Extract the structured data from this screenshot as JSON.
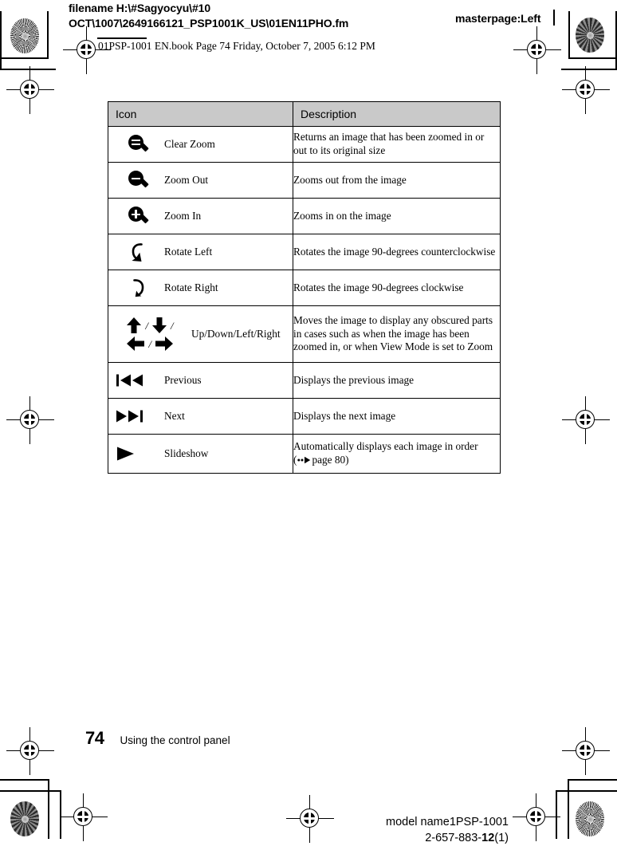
{
  "prepress": {
    "filename_line1": "filename H:\\#Sagyocyu\\#10",
    "filename_line2": "OCT\\1007\\2649166121_PSP1001K_US\\01EN11PHO.fm",
    "masterpage": "masterpage:Left",
    "book_line": "01PSP-1001 EN.book  Page 74  Friday, October 7, 2005  6:12 PM"
  },
  "table": {
    "headers": [
      "Icon",
      "Description"
    ],
    "header_bg": "#c9c9c9",
    "rows": [
      {
        "icon": "magnifier-equal-icon",
        "label": "Clear Zoom",
        "description": "Returns an image that has been zoomed in or out to its original size"
      },
      {
        "icon": "magnifier-minus-icon",
        "label": "Zoom Out",
        "description": "Zooms out from the image"
      },
      {
        "icon": "magnifier-plus-icon",
        "label": "Zoom In",
        "description": "Zooms in on the image"
      },
      {
        "icon": "rotate-left-icon",
        "label": "Rotate Left",
        "description": "Rotates the image 90-degrees counterclockwise"
      },
      {
        "icon": "rotate-right-icon",
        "label": "Rotate Right",
        "description": "Rotates the image 90-degrees clockwise"
      },
      {
        "icon": "direction-arrows-icon",
        "label": "Up/Down/Left/Right",
        "description": "Moves the image to display any obscured parts in cases such as when the image has been zoomed in, or when View Mode is set to Zoom"
      },
      {
        "icon": "previous-icon",
        "label": "Previous",
        "description": "Displays the previous image"
      },
      {
        "icon": "next-icon",
        "label": "Next",
        "description": "Displays the next image"
      },
      {
        "icon": "slideshow-icon",
        "label": "Slideshow",
        "description": "Automatically displays each image in order",
        "xref_prefix": "(",
        "xref_text": "page 80",
        "xref_suffix": ")"
      }
    ]
  },
  "footer": {
    "page_number": "74",
    "section": "Using the control panel"
  },
  "colophon": {
    "model": "model name1PSP-1001",
    "code_main": "2-657-883-",
    "code_bold": "12",
    "code_tail": "(1)"
  }
}
